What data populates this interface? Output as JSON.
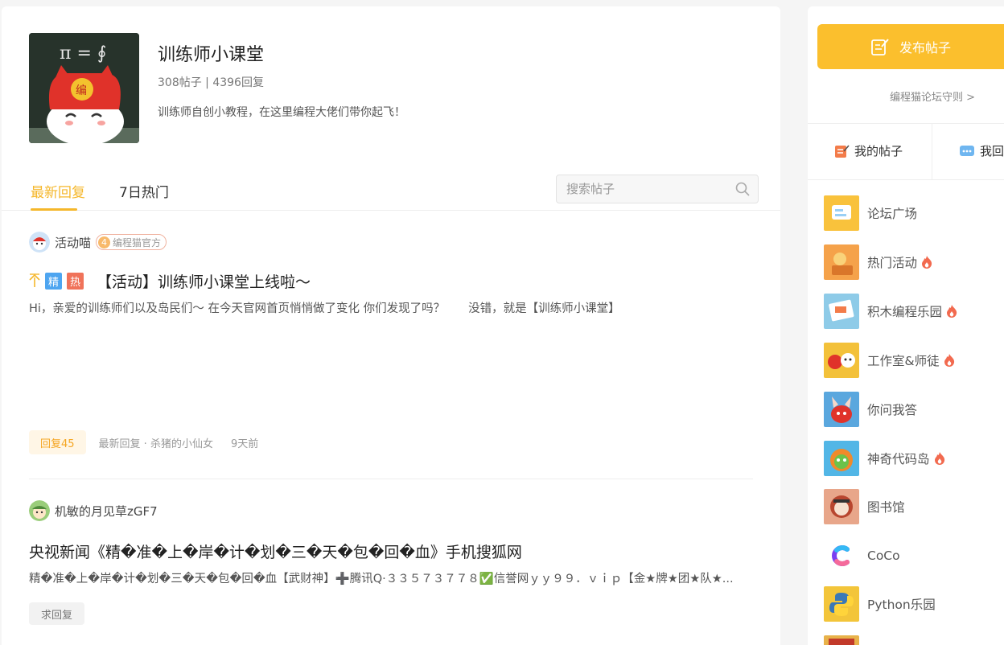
{
  "forum": {
    "title": "训练师小课堂",
    "stats": "308帖子 | 4396回复",
    "description": "训练师自创小教程，在这里编程大佬们带你起飞！"
  },
  "tabs": [
    {
      "label": "最新回复",
      "active": true
    },
    {
      "label": "7日热门",
      "active": false
    }
  ],
  "search": {
    "placeholder": "搜索帖子"
  },
  "posts": [
    {
      "author": "活动喵",
      "badge_num": "4",
      "badge_text": "编程猫官方",
      "tags": [
        "精",
        "热"
      ],
      "title": "【活动】训练师小课堂上线啦～",
      "summary": "Hi，亲爱的训练师们以及岛民们～ 在今天官网首页悄悄做了变化 你们发现了吗？　　没错，就是【训练师小课堂】",
      "reply_count": "回复45",
      "last_reply": "最新回复 · 杀猪的小仙女",
      "time": "9天前"
    },
    {
      "author": "机敏的月见草zGF7",
      "title": "央视新闻《精�准�上�岸�计�划�三�天�包�回�血》手机搜狐网",
      "summary": "精�准�上�岸�计�划�三�天�包�回�血【武财神】➕腾讯Q·３３５７３７７８✅信誉网ｙｙ９９．ｖｉｐ【金★牌★团★队★...",
      "action": "求回复"
    }
  ],
  "sidebar": {
    "publish_label": "发布帖子",
    "rules_link": "编程猫论坛守则 >",
    "my_posts": "我的帖子",
    "my_replies": "我回",
    "nav": [
      {
        "label": "论坛广场",
        "hot": false
      },
      {
        "label": "热门活动",
        "hot": true
      },
      {
        "label": "积木编程乐园",
        "hot": true
      },
      {
        "label": "工作室&师徒",
        "hot": true
      },
      {
        "label": "你问我答",
        "hot": false
      },
      {
        "label": "神奇代码岛",
        "hot": true
      },
      {
        "label": "图书馆",
        "hot": false
      },
      {
        "label": "CoCo",
        "hot": false
      },
      {
        "label": "Python乐园",
        "hot": false
      }
    ]
  },
  "colors": {
    "accent": "#f5b72b",
    "publish_bg": "#fbbf2d",
    "hot": "#f26a4f",
    "tag_jing": "#4ea5f0",
    "tag_re": "#f0735a"
  }
}
